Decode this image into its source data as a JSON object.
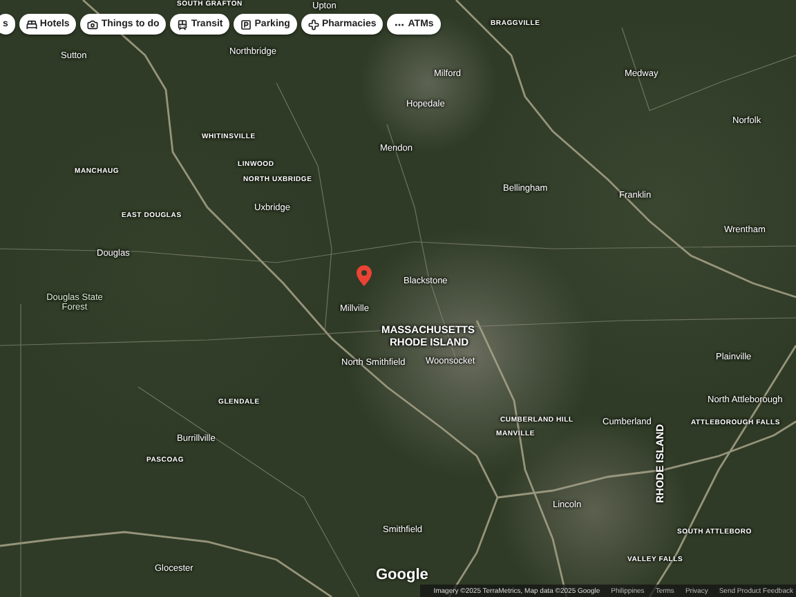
{
  "category_chips": [
    {
      "label": "s",
      "kind": "partial"
    },
    {
      "label": "Hotels",
      "kind": "hotels"
    },
    {
      "label": "Things to do",
      "kind": "things"
    },
    {
      "label": "Transit",
      "kind": "transit"
    },
    {
      "label": "Parking",
      "kind": "parking"
    },
    {
      "label": "Pharmacies",
      "kind": "pharmacies"
    },
    {
      "label": "ATMs",
      "kind": "atms"
    }
  ],
  "map_labels": [
    {
      "text": "SOUTH GRAFTON",
      "kind": "village"
    },
    {
      "text": "Upton",
      "kind": "town"
    },
    {
      "text": "Sutton",
      "kind": "town"
    },
    {
      "text": "Northbridge",
      "kind": "town"
    },
    {
      "text": "BRAGGVILLE",
      "kind": "village"
    },
    {
      "text": "Milford",
      "kind": "town"
    },
    {
      "text": "Hopedale",
      "kind": "town"
    },
    {
      "text": "Medway",
      "kind": "town"
    },
    {
      "text": "Norfolk",
      "kind": "town"
    },
    {
      "text": "WHITINSVILLE",
      "kind": "village"
    },
    {
      "text": "MANCHAUG",
      "kind": "village"
    },
    {
      "text": "LINWOOD",
      "kind": "village"
    },
    {
      "text": "NORTH UXBRIDGE",
      "kind": "village"
    },
    {
      "text": "Mendon",
      "kind": "town"
    },
    {
      "text": "Bellingham",
      "kind": "town"
    },
    {
      "text": "Franklin",
      "kind": "town"
    },
    {
      "text": "Uxbridge",
      "kind": "town"
    },
    {
      "text": "EAST DOUGLAS",
      "kind": "village"
    },
    {
      "text": "Wrentham",
      "kind": "town"
    },
    {
      "text": "Douglas",
      "kind": "town"
    },
    {
      "text": "Blackstone",
      "kind": "town"
    },
    {
      "text": "Douglas State Forest",
      "kind": "park"
    },
    {
      "text": "Millville",
      "kind": "town"
    },
    {
      "text": "MASSACHUSETTS",
      "kind": "state"
    },
    {
      "text": "RHODE ISLAND",
      "kind": "state"
    },
    {
      "text": "North Smithfield",
      "kind": "town"
    },
    {
      "text": "Woonsocket",
      "kind": "town"
    },
    {
      "text": "Plainville",
      "kind": "town"
    },
    {
      "text": "GLENDALE",
      "kind": "village"
    },
    {
      "text": "North Attleborough",
      "kind": "town"
    },
    {
      "text": "CUMBERLAND HILL",
      "kind": "village"
    },
    {
      "text": "Cumberland",
      "kind": "town"
    },
    {
      "text": "RHODE ISLAND",
      "kind": "state-vertical"
    },
    {
      "text": "ATTLEBOROUGH FALLS",
      "kind": "village"
    },
    {
      "text": "MANVILLE",
      "kind": "village"
    },
    {
      "text": "Burrillville",
      "kind": "town"
    },
    {
      "text": "PASCOAG",
      "kind": "village"
    },
    {
      "text": "Lincoln",
      "kind": "town"
    },
    {
      "text": "Smithfield",
      "kind": "town"
    },
    {
      "text": "SOUTH ATTLEBORO",
      "kind": "village"
    },
    {
      "text": "VALLEY FALLS",
      "kind": "village"
    },
    {
      "text": "Glocester",
      "kind": "town"
    }
  ],
  "logo": "Google",
  "attribution": {
    "credit": "Imagery ©2025 TerraMetrics, Map data ©2025 Google",
    "links": [
      "Philippines",
      "Terms",
      "Privacy",
      "Send Product Feedback"
    ]
  }
}
